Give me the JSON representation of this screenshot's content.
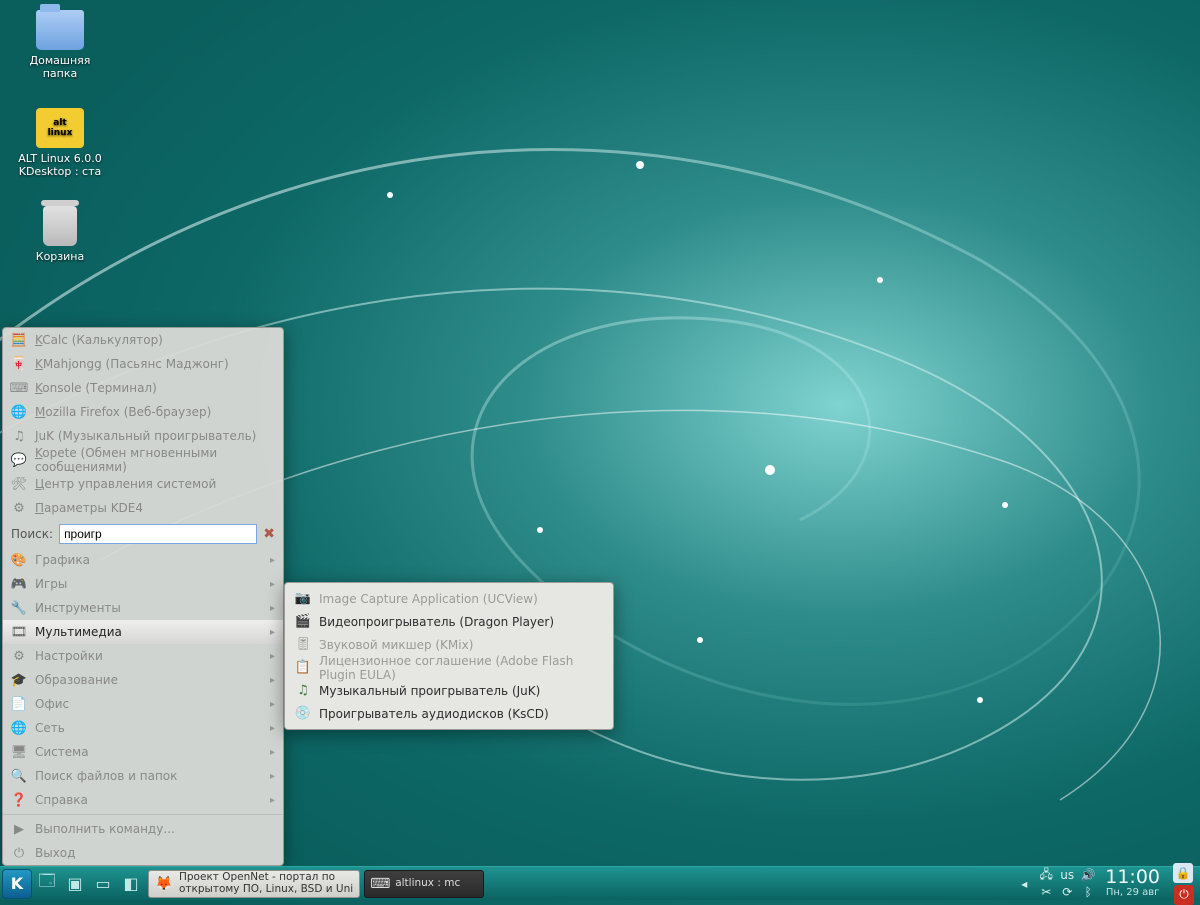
{
  "desktop": {
    "icons": [
      {
        "name": "home-folder",
        "label": "Домашняя\nпапка",
        "kind": "folder"
      },
      {
        "name": "alt-linux",
        "label": "ALT Linux 6.0.0\nKDesktop : ста",
        "kind": "alt"
      },
      {
        "name": "trash",
        "label": "Корзина",
        "kind": "trash"
      }
    ]
  },
  "kmenu": {
    "favorites": [
      {
        "label": "KCalc (Калькулятор)",
        "icon": "calc-icon"
      },
      {
        "label": "KMahjongg (Пасьянс Маджонг)",
        "icon": "mahjongg-icon"
      },
      {
        "label": "Konsole (Терминал)",
        "icon": "terminal-icon"
      },
      {
        "label": "Mozilla Firefox (Веб-браузер)",
        "icon": "globe-icon"
      },
      {
        "label": "JuK (Музыкальный проигрыватель)",
        "icon": "music-icon"
      },
      {
        "label": "Kopete (Обмен мгновенными сообщениями)",
        "icon": "chat-icon"
      },
      {
        "label": "Центр управления системой",
        "icon": "control-center-icon"
      },
      {
        "label": "Параметры KDE4",
        "icon": "settings-icon"
      }
    ],
    "search_label": "Поиск:",
    "search_value": "проигр",
    "categories": [
      {
        "label": "Графика",
        "icon": "graphics-icon",
        "enabled": false
      },
      {
        "label": "Игры",
        "icon": "games-icon",
        "enabled": false
      },
      {
        "label": "Инструменты",
        "icon": "tools-icon",
        "enabled": false
      },
      {
        "label": "Мультимедиа",
        "icon": "multimedia-icon",
        "enabled": true,
        "hovered": true
      },
      {
        "label": "Настройки",
        "icon": "preferences-icon",
        "enabled": false
      },
      {
        "label": "Образование",
        "icon": "education-icon",
        "enabled": false
      },
      {
        "label": "Офис",
        "icon": "office-icon",
        "enabled": false
      },
      {
        "label": "Сеть",
        "icon": "network-icon",
        "enabled": false
      },
      {
        "label": "Система",
        "icon": "system-icon",
        "enabled": false
      },
      {
        "label": "Поиск файлов и папок",
        "icon": "find-icon",
        "enabled": false
      },
      {
        "label": "Справка",
        "icon": "help-icon",
        "enabled": false
      }
    ],
    "footer": [
      {
        "label": "Выполнить команду...",
        "icon": "run-icon"
      },
      {
        "label": "Выход",
        "icon": "logout-icon"
      }
    ]
  },
  "submenu": {
    "items": [
      {
        "label": "Image Capture Application (UCView)",
        "icon": "camera-icon",
        "enabled": false
      },
      {
        "label": "Видеопроигрыватель (Dragon Player)",
        "icon": "video-icon",
        "enabled": true
      },
      {
        "label": "Звуковой микшер (KMix)",
        "icon": "mixer-icon",
        "enabled": false
      },
      {
        "label": "Лицензионное соглашение (Adobe Flash Plugin EULA)",
        "icon": "license-icon",
        "enabled": false
      },
      {
        "label": "Музыкальный проигрыватель (JuK)",
        "icon": "music-icon",
        "enabled": true
      },
      {
        "label": "Проигрыватель аудиодисков (KsCD)",
        "icon": "cd-icon",
        "enabled": true
      }
    ]
  },
  "taskbar": {
    "tasks": [
      {
        "label": "Проект OpenNet - портал по\nоткрытому ПО, Linux, BSD и Uni",
        "icon": "firefox-icon",
        "name": "task-firefox"
      },
      {
        "label": "altlinux : mc",
        "icon": "terminal-icon",
        "name": "task-terminal",
        "dark": true
      }
    ],
    "tray": {
      "icons": [
        "network-tray-icon",
        "keyboard-layout-icon",
        "volume-icon",
        "scissors-icon",
        "updates-icon",
        "bluetooth-icon"
      ],
      "layout_label": "us"
    },
    "clock": {
      "time": "11:00",
      "date": "Пн, 29 авг"
    }
  },
  "icon_glyphs": {
    "calc-icon": "🧮",
    "mahjongg-icon": "🀄",
    "terminal-icon": "⌨",
    "globe-icon": "🌐",
    "music-icon": "♫",
    "chat-icon": "💬",
    "control-center-icon": "🛠",
    "settings-icon": "⚙",
    "graphics-icon": "🎨",
    "games-icon": "🎮",
    "tools-icon": "🔧",
    "multimedia-icon": "🎞",
    "preferences-icon": "⚙",
    "education-icon": "🎓",
    "office-icon": "📄",
    "network-icon": "🌐",
    "system-icon": "🖥",
    "find-icon": "🔍",
    "help-icon": "❓",
    "run-icon": "▶",
    "logout-icon": "⏻",
    "camera-icon": "📷",
    "video-icon": "🎬",
    "mixer-icon": "🎚",
    "license-icon": "📋",
    "cd-icon": "💿",
    "firefox-icon": "🦊",
    "network-tray-icon": "🖧",
    "keyboard-layout-icon": "⌨",
    "volume-icon": "🔊",
    "scissors-icon": "✂",
    "updates-icon": "⟳",
    "bluetooth-icon": "ᛒ",
    "clear-icon": "✖",
    "desktop-icon": "🗔",
    "windows-icon": "▣"
  }
}
